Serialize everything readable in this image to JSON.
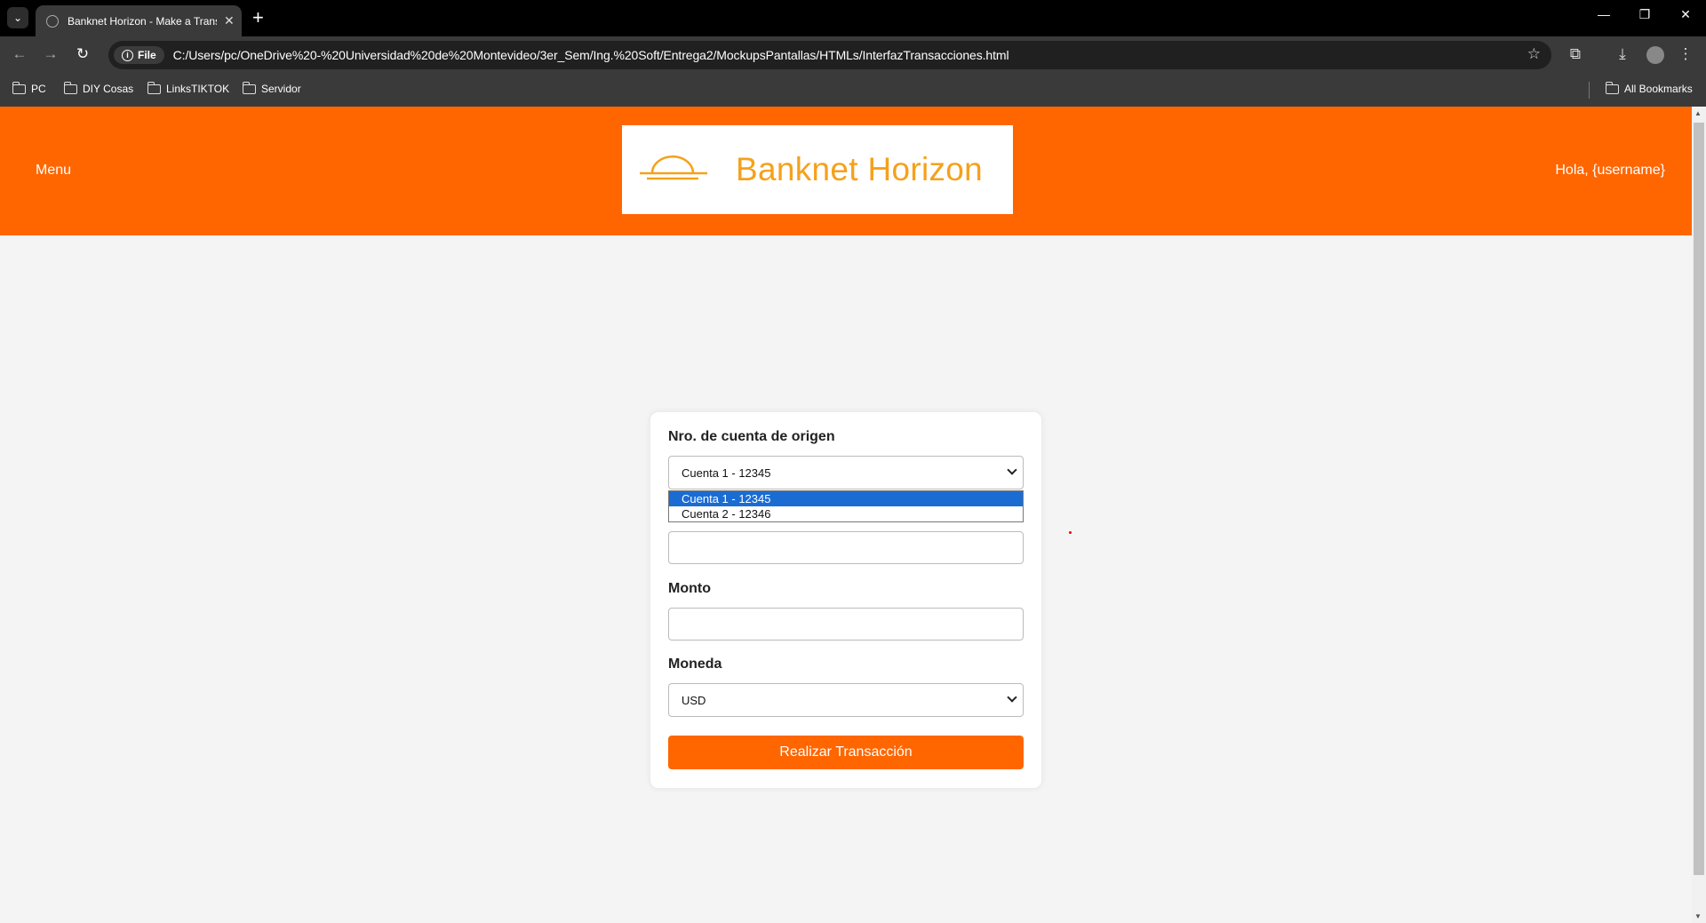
{
  "browser": {
    "tab_title": "Banknet Horizon - Make a Transaction",
    "file_chip": "File",
    "url": "C:/Users/pc/OneDrive%20-%20Universidad%20de%20Montevideo/3er_Sem/Ing.%20Soft/Entrega2/MockupsPantallas/HTMLs/InterfazTransacciones.html",
    "bookmarks": [
      "PC",
      "DIY Cosas",
      "LinksTIKTOK",
      "Servidor"
    ],
    "all_bookmarks": "All Bookmarks"
  },
  "header": {
    "menu_label": "Menu",
    "logo_text": "Banknet Horizon",
    "greeting": "Hola, {username}",
    "brand_color": "#ff6600"
  },
  "form": {
    "origin_label": "Nro. de cuenta de origen",
    "origin_selected": "Cuenta 1 - 12345",
    "origin_options": [
      "Cuenta 1 - 12345",
      "Cuenta 2 - 12346"
    ],
    "destination_value": "",
    "amount_label": "Monto",
    "amount_value": "",
    "currency_label": "Moneda",
    "currency_selected": "USD",
    "submit_label": "Realizar Transacción"
  }
}
